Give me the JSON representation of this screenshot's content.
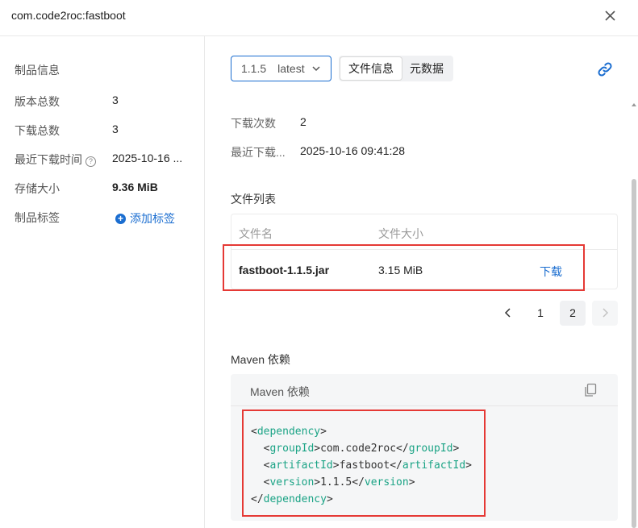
{
  "header": {
    "title": "com.code2roc:fastboot"
  },
  "sidebar": {
    "section_title": "制品信息",
    "rows": [
      {
        "label": "版本总数",
        "value": "3"
      },
      {
        "label": "下载总数",
        "value": "3"
      },
      {
        "label": "最近下载时间",
        "value": "2025-10-16 ..."
      },
      {
        "label": "存储大小",
        "value": "9.36 MiB"
      },
      {
        "label": "制品标签",
        "value": "添加标签"
      }
    ],
    "help_glyph": "?"
  },
  "toolbar": {
    "version": "1.1.5",
    "version_tag": "latest",
    "tabs": [
      "文件信息",
      "元数据"
    ],
    "active_tab": "文件信息"
  },
  "info": {
    "download_count_label": "下载次数",
    "download_count": "2",
    "last_download_label": "最近下载...",
    "last_download": "2025-10-16 09:41:28"
  },
  "files": {
    "title": "文件列表",
    "columns": [
      "文件名",
      "文件大小"
    ],
    "rows": [
      {
        "name": "fastboot-1.1.5.jar",
        "size": "3.15 MiB",
        "action": "下载"
      }
    ]
  },
  "pagination": {
    "pages": [
      "1",
      "2"
    ],
    "current": "2"
  },
  "maven": {
    "section_title": "Maven 依赖",
    "box_title": "Maven 依赖",
    "code": {
      "dependency_tag": "dependency",
      "groupId_tag": "groupId",
      "groupId": "com.code2roc",
      "artifactId_tag": "artifactId",
      "artifactId": "fastboot",
      "version_tag": "version",
      "version": "1.1.5"
    }
  },
  "colors": {
    "accent": "#1a6dd0",
    "highlight": "#e53935",
    "xml_tag": "#1aa385"
  },
  "icons": [
    "close-icon",
    "chevron-down-icon",
    "link-icon",
    "copy-icon",
    "plus-circle-icon",
    "help-icon",
    "chevron-left-icon",
    "chevron-right-icon"
  ]
}
